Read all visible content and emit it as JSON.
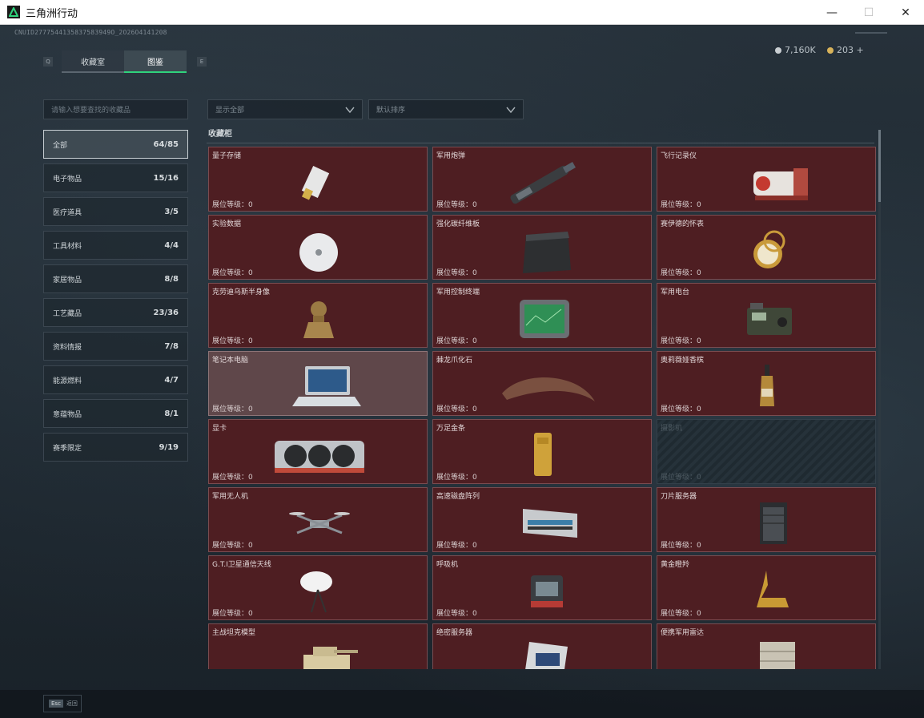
{
  "window": {
    "title": "三角洲行动",
    "minimize": "—",
    "maximize": "☐",
    "close": "✕"
  },
  "header": {
    "uid": "CNUID2777544135837583949O_2O26O4141208",
    "key_left": "Q",
    "key_right": "E",
    "tabs": [
      {
        "label": "收藏室"
      },
      {
        "label": "图鉴"
      }
    ],
    "currency": [
      {
        "value": "7,160K",
        "color": "#c9ced2"
      },
      {
        "value": "203 +",
        "color": "#d8b35a"
      }
    ]
  },
  "sidebar": {
    "search_placeholder": "请输入想要查找的收藏品",
    "items": [
      {
        "label": "全部",
        "count": "64/85"
      },
      {
        "label": "电子物品",
        "count": "15/16"
      },
      {
        "label": "医疗道具",
        "count": "3/5"
      },
      {
        "label": "工具材料",
        "count": "4/4"
      },
      {
        "label": "家居物品",
        "count": "8/8"
      },
      {
        "label": "工艺藏品",
        "count": "23/36"
      },
      {
        "label": "资料情报",
        "count": "7/8"
      },
      {
        "label": "能源燃料",
        "count": "4/7"
      },
      {
        "label": "意蕴物品",
        "count": "8/1"
      },
      {
        "label": "赛季限定",
        "count": "9/19"
      }
    ]
  },
  "filters": {
    "display": "显示全部",
    "sort": "默认排序"
  },
  "main": {
    "section_title": "收藏柜",
    "level_label": "展位等级：0",
    "items": [
      {
        "name": "量子存储",
        "icon": "usb-drive-icon",
        "state": "normal"
      },
      {
        "name": "军用炮弹",
        "icon": "artillery-shell-icon",
        "state": "normal"
      },
      {
        "name": "飞行记录仪",
        "icon": "flight-recorder-icon",
        "state": "normal"
      },
      {
        "name": "实验数据",
        "icon": "disc-icon",
        "state": "normal"
      },
      {
        "name": "强化碳纤维板",
        "icon": "carbon-plate-icon",
        "state": "normal"
      },
      {
        "name": "赛伊德的怀表",
        "icon": "pocket-watch-icon",
        "state": "normal"
      },
      {
        "name": "克劳迪乌斯半身像",
        "icon": "bust-icon",
        "state": "normal"
      },
      {
        "name": "军用控制终端",
        "icon": "control-terminal-icon",
        "state": "normal"
      },
      {
        "name": "军用电台",
        "icon": "radio-icon",
        "state": "normal"
      },
      {
        "name": "笔记本电脑",
        "icon": "laptop-icon",
        "state": "highlight"
      },
      {
        "name": "棘龙爪化石",
        "icon": "claw-fossil-icon",
        "state": "normal"
      },
      {
        "name": "奥莉薇娅香槟",
        "icon": "champagne-icon",
        "state": "normal"
      },
      {
        "name": "显卡",
        "icon": "graphics-card-icon",
        "state": "normal"
      },
      {
        "name": "万足金条",
        "icon": "gold-bar-icon",
        "state": "normal"
      },
      {
        "name": "摄影机",
        "icon": "camera-icon",
        "state": "locked"
      },
      {
        "name": "军用无人机",
        "icon": "drone-icon",
        "state": "normal"
      },
      {
        "name": "高速磁盘阵列",
        "icon": "disk-array-icon",
        "state": "normal"
      },
      {
        "name": "刀片服务器",
        "icon": "server-icon",
        "state": "normal"
      },
      {
        "name": "G.T.I卫星通信天线",
        "icon": "satellite-dish-icon",
        "state": "normal"
      },
      {
        "name": "呼吸机",
        "icon": "ventilator-icon",
        "state": "normal"
      },
      {
        "name": "黄金瞪羚",
        "icon": "gold-gazelle-icon",
        "state": "normal"
      },
      {
        "name": "主战坦克模型",
        "icon": "tank-model-icon",
        "state": "normal"
      },
      {
        "name": "绝密服务器",
        "icon": "secret-server-icon",
        "state": "normal"
      },
      {
        "name": "便携军用雷达",
        "icon": "radar-icon",
        "state": "normal"
      }
    ]
  },
  "footer": {
    "esc_key": "Esc",
    "esc_label": "返回"
  }
}
